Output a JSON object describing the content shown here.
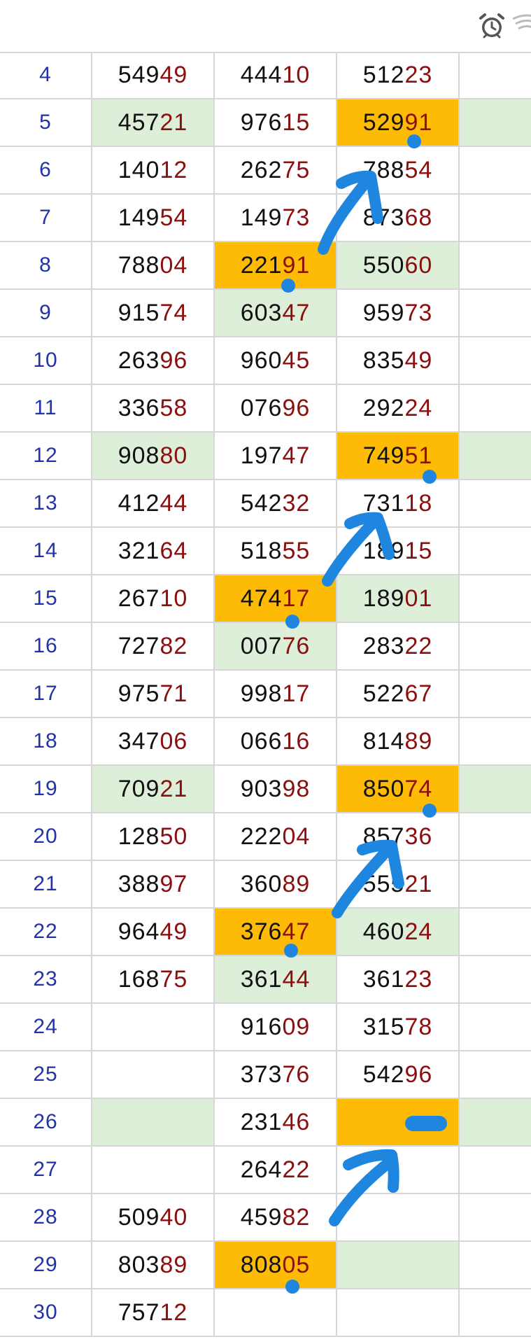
{
  "status_icons": [
    "alarm-clock-icon",
    "wifi-icon"
  ],
  "colors": {
    "highlight_green": "#deefd9",
    "highlight_orange": "#fdbb05",
    "arrow_blue": "#1f86e0",
    "row_number": "#2233aa",
    "digit_tail": "#8b0f0f"
  },
  "rows": [
    {
      "num": "4",
      "cells": [
        {
          "h": "549",
          "t": "49"
        },
        {
          "h": "444",
          "t": "10"
        },
        {
          "h": "512",
          "t": "23"
        },
        {}
      ]
    },
    {
      "num": "5",
      "cells": [
        {
          "h": "457",
          "t": "21",
          "bg": "green"
        },
        {
          "h": "976",
          "t": "15"
        },
        {
          "h": "529",
          "t": "91",
          "bg": "orange"
        },
        {
          "bg": "green"
        }
      ]
    },
    {
      "num": "6",
      "cells": [
        {
          "h": "140",
          "t": "12"
        },
        {
          "h": "262",
          "t": "75"
        },
        {
          "h": "788",
          "t": "54"
        },
        {}
      ]
    },
    {
      "num": "7",
      "cells": [
        {
          "h": "149",
          "t": "54"
        },
        {
          "h": "149",
          "t": "73"
        },
        {
          "h": "873",
          "t": "68"
        },
        {}
      ]
    },
    {
      "num": "8",
      "cells": [
        {
          "h": "788",
          "t": "04"
        },
        {
          "h": "221",
          "t": "91",
          "bg": "orange"
        },
        {
          "h": "550",
          "t": "60",
          "bg": "green"
        },
        {}
      ]
    },
    {
      "num": "9",
      "cells": [
        {
          "h": "915",
          "t": "74"
        },
        {
          "h": "603",
          "t": "47",
          "bg": "green"
        },
        {
          "h": "959",
          "t": "73"
        },
        {}
      ]
    },
    {
      "num": "10",
      "cells": [
        {
          "h": "263",
          "t": "96"
        },
        {
          "h": "960",
          "t": "45"
        },
        {
          "h": "835",
          "t": "49"
        },
        {}
      ]
    },
    {
      "num": "11",
      "cells": [
        {
          "h": "336",
          "t": "58"
        },
        {
          "h": "076",
          "t": "96"
        },
        {
          "h": "292",
          "t": "24"
        },
        {}
      ]
    },
    {
      "num": "12",
      "cells": [
        {
          "h": "908",
          "t": "80",
          "bg": "green"
        },
        {
          "h": "197",
          "t": "47"
        },
        {
          "h": "749",
          "t": "51",
          "bg": "orange"
        },
        {
          "bg": "green"
        }
      ]
    },
    {
      "num": "13",
      "cells": [
        {
          "h": "412",
          "t": "44"
        },
        {
          "h": "542",
          "t": "32"
        },
        {
          "h": "731",
          "t": "18"
        },
        {}
      ]
    },
    {
      "num": "14",
      "cells": [
        {
          "h": "321",
          "t": "64"
        },
        {
          "h": "518",
          "t": "55"
        },
        {
          "h": "189",
          "t": "15"
        },
        {}
      ]
    },
    {
      "num": "15",
      "cells": [
        {
          "h": "267",
          "t": "10"
        },
        {
          "h": "474",
          "t": "17",
          "bg": "orange"
        },
        {
          "h": "189",
          "t": "01",
          "bg": "green"
        },
        {}
      ]
    },
    {
      "num": "16",
      "cells": [
        {
          "h": "727",
          "t": "82"
        },
        {
          "h": "007",
          "t": "76",
          "bg": "green"
        },
        {
          "h": "283",
          "t": "22"
        },
        {}
      ]
    },
    {
      "num": "17",
      "cells": [
        {
          "h": "975",
          "t": "71"
        },
        {
          "h": "998",
          "t": "17"
        },
        {
          "h": "522",
          "t": "67"
        },
        {}
      ]
    },
    {
      "num": "18",
      "cells": [
        {
          "h": "347",
          "t": "06"
        },
        {
          "h": "066",
          "t": "16"
        },
        {
          "h": "814",
          "t": "89"
        },
        {}
      ]
    },
    {
      "num": "19",
      "cells": [
        {
          "h": "709",
          "t": "21",
          "bg": "green"
        },
        {
          "h": "903",
          "t": "98"
        },
        {
          "h": "850",
          "t": "74",
          "bg": "orange"
        },
        {
          "bg": "green"
        }
      ]
    },
    {
      "num": "20",
      "cells": [
        {
          "h": "128",
          "t": "50"
        },
        {
          "h": "222",
          "t": "04"
        },
        {
          "h": "857",
          "t": "36"
        },
        {}
      ]
    },
    {
      "num": "21",
      "cells": [
        {
          "h": "388",
          "t": "97"
        },
        {
          "h": "360",
          "t": "89"
        },
        {
          "h": "555",
          "t": "21"
        },
        {}
      ]
    },
    {
      "num": "22",
      "cells": [
        {
          "h": "964",
          "t": "49"
        },
        {
          "h": "376",
          "t": "47",
          "bg": "orange"
        },
        {
          "h": "460",
          "t": "24",
          "bg": "green"
        },
        {}
      ]
    },
    {
      "num": "23",
      "cells": [
        {
          "h": "168",
          "t": "75"
        },
        {
          "h": "361",
          "t": "44",
          "bg": "green"
        },
        {
          "h": "361",
          "t": "23"
        },
        {}
      ]
    },
    {
      "num": "24",
      "cells": [
        {},
        {
          "h": "916",
          "t": "09"
        },
        {
          "h": "315",
          "t": "78"
        },
        {}
      ]
    },
    {
      "num": "25",
      "cells": [
        {},
        {
          "h": "373",
          "t": "76"
        },
        {
          "h": "542",
          "t": "96"
        },
        {}
      ]
    },
    {
      "num": "26",
      "cells": [
        {
          "bg": "green"
        },
        {
          "h": "231",
          "t": "46"
        },
        {
          "bg": "orange"
        },
        {
          "bg": "green"
        }
      ]
    },
    {
      "num": "27",
      "cells": [
        {},
        {
          "h": "264",
          "t": "22"
        },
        {},
        {}
      ]
    },
    {
      "num": "28",
      "cells": [
        {
          "h": "509",
          "t": "40"
        },
        {
          "h": "459",
          "t": "82"
        },
        {},
        {}
      ]
    },
    {
      "num": "29",
      "cells": [
        {
          "h": "803",
          "t": "89"
        },
        {
          "h": "808",
          "t": "05",
          "bg": "orange"
        },
        {
          "bg": "green"
        },
        {}
      ]
    },
    {
      "num": "30",
      "cells": [
        {
          "h": "757",
          "t": "12"
        },
        {},
        {},
        {}
      ]
    }
  ]
}
